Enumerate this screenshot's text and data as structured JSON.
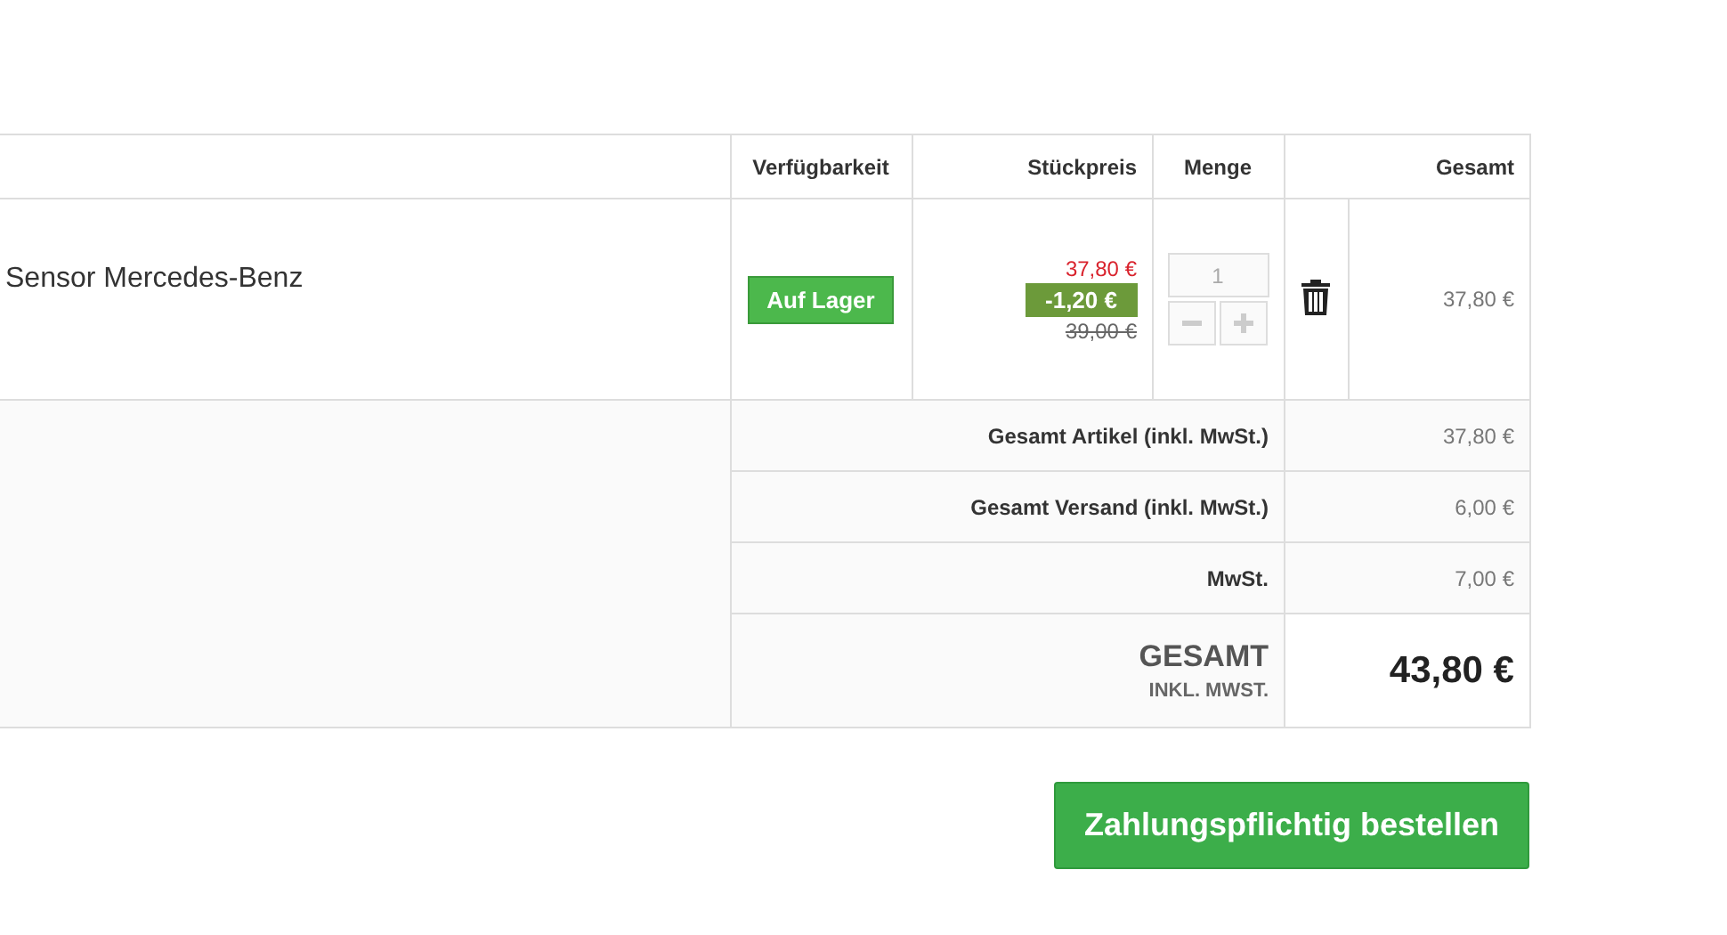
{
  "columns": [
    "Verfügbarkeit",
    "Stückpreis",
    "Menge",
    "Gesamt"
  ],
  "item": {
    "name": "Sensor Mercedes-Benz",
    "availability": "Auf Lager",
    "price": "37,80 €",
    "discount": "-1,20 €",
    "old_price": "39,00 €",
    "quantity": "1",
    "total": "37,80 €"
  },
  "summary": [
    {
      "label": "Gesamt Artikel (inkl. MwSt.)",
      "value": "37,80 €"
    },
    {
      "label": "Gesamt Versand (inkl. MwSt.)",
      "value": "6,00 €"
    },
    {
      "label": "MwSt.",
      "value": "7,00 €"
    }
  ],
  "grand_total": {
    "label": "GESAMT",
    "sublabel": "INKL. MWST.",
    "value": "43,80 €"
  },
  "order_button": "Zahlungspflichtig bestellen"
}
